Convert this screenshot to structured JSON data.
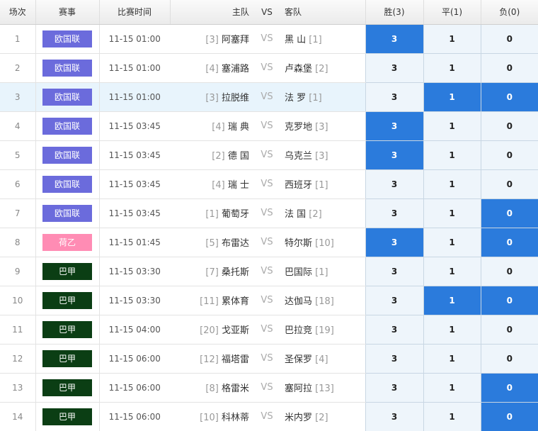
{
  "header": {
    "num": "场次",
    "league": "赛事",
    "time": "比赛时间",
    "home": "主队",
    "vs": "VS",
    "away": "客队",
    "win": "胜(3)",
    "draw": "平(1)",
    "lose": "负(0)"
  },
  "colors": {
    "欧国联": "#6b6bdc",
    "荷乙": "#ff8cb4",
    "巴甲": "#0b3e14",
    "selected": "#2b7bdc",
    "cell": "#eef5fb"
  },
  "rows": [
    {
      "num": "1",
      "league": "欧国联",
      "time": "11-15 01:00",
      "home_rank": "[3]",
      "home": "阿塞拜",
      "away": "黑 山",
      "away_rank": "[1]",
      "win": "3",
      "draw": "1",
      "lose": "0",
      "selected": [
        "win"
      ]
    },
    {
      "num": "2",
      "league": "欧国联",
      "time": "11-15 01:00",
      "home_rank": "[4]",
      "home": "塞浦路",
      "away": "卢森堡",
      "away_rank": "[2]",
      "win": "3",
      "draw": "1",
      "lose": "0",
      "selected": []
    },
    {
      "num": "3",
      "league": "欧国联",
      "time": "11-15 01:00",
      "home_rank": "[3]",
      "home": "拉脱维",
      "away": "法 罗",
      "away_rank": "[1]",
      "win": "3",
      "draw": "1",
      "lose": "0",
      "selected": [
        "draw",
        "lose"
      ]
    },
    {
      "num": "4",
      "league": "欧国联",
      "time": "11-15 03:45",
      "home_rank": "[4]",
      "home": "瑞 典",
      "away": "克罗地",
      "away_rank": "[3]",
      "win": "3",
      "draw": "1",
      "lose": "0",
      "selected": [
        "win"
      ]
    },
    {
      "num": "5",
      "league": "欧国联",
      "time": "11-15 03:45",
      "home_rank": "[2]",
      "home": "德 国",
      "away": "乌克兰",
      "away_rank": "[3]",
      "win": "3",
      "draw": "1",
      "lose": "0",
      "selected": [
        "win"
      ]
    },
    {
      "num": "6",
      "league": "欧国联",
      "time": "11-15 03:45",
      "home_rank": "[4]",
      "home": "瑞 士",
      "away": "西班牙",
      "away_rank": "[1]",
      "win": "3",
      "draw": "1",
      "lose": "0",
      "selected": []
    },
    {
      "num": "7",
      "league": "欧国联",
      "time": "11-15 03:45",
      "home_rank": "[1]",
      "home": "葡萄牙",
      "away": "法 国",
      "away_rank": "[2]",
      "win": "3",
      "draw": "1",
      "lose": "0",
      "selected": [
        "lose"
      ]
    },
    {
      "num": "8",
      "league": "荷乙",
      "time": "11-15 01:45",
      "home_rank": "[5]",
      "home": "布雷达",
      "away": "特尔斯",
      "away_rank": "[10]",
      "win": "3",
      "draw": "1",
      "lose": "0",
      "selected": [
        "win",
        "lose"
      ]
    },
    {
      "num": "9",
      "league": "巴甲",
      "time": "11-15 03:30",
      "home_rank": "[7]",
      "home": "桑托斯",
      "away": "巴国际",
      "away_rank": "[1]",
      "win": "3",
      "draw": "1",
      "lose": "0",
      "selected": []
    },
    {
      "num": "10",
      "league": "巴甲",
      "time": "11-15 03:30",
      "home_rank": "[11]",
      "home": "累体育",
      "away": "达伽马",
      "away_rank": "[18]",
      "win": "3",
      "draw": "1",
      "lose": "0",
      "selected": [
        "draw",
        "lose"
      ]
    },
    {
      "num": "11",
      "league": "巴甲",
      "time": "11-15 04:00",
      "home_rank": "[20]",
      "home": "戈亚斯",
      "away": "巴拉竞",
      "away_rank": "[19]",
      "win": "3",
      "draw": "1",
      "lose": "0",
      "selected": []
    },
    {
      "num": "12",
      "league": "巴甲",
      "time": "11-15 06:00",
      "home_rank": "[12]",
      "home": "福塔雷",
      "away": "圣保罗",
      "away_rank": "[4]",
      "win": "3",
      "draw": "1",
      "lose": "0",
      "selected": []
    },
    {
      "num": "13",
      "league": "巴甲",
      "time": "11-15 06:00",
      "home_rank": "[8]",
      "home": "格雷米",
      "away": "塞阿拉",
      "away_rank": "[13]",
      "win": "3",
      "draw": "1",
      "lose": "0",
      "selected": [
        "lose"
      ]
    },
    {
      "num": "14",
      "league": "巴甲",
      "time": "11-15 06:00",
      "home_rank": "[10]",
      "home": "科林蒂",
      "away": "米内罗",
      "away_rank": "[2]",
      "win": "3",
      "draw": "1",
      "lose": "0",
      "selected": [
        "lose"
      ]
    }
  ]
}
